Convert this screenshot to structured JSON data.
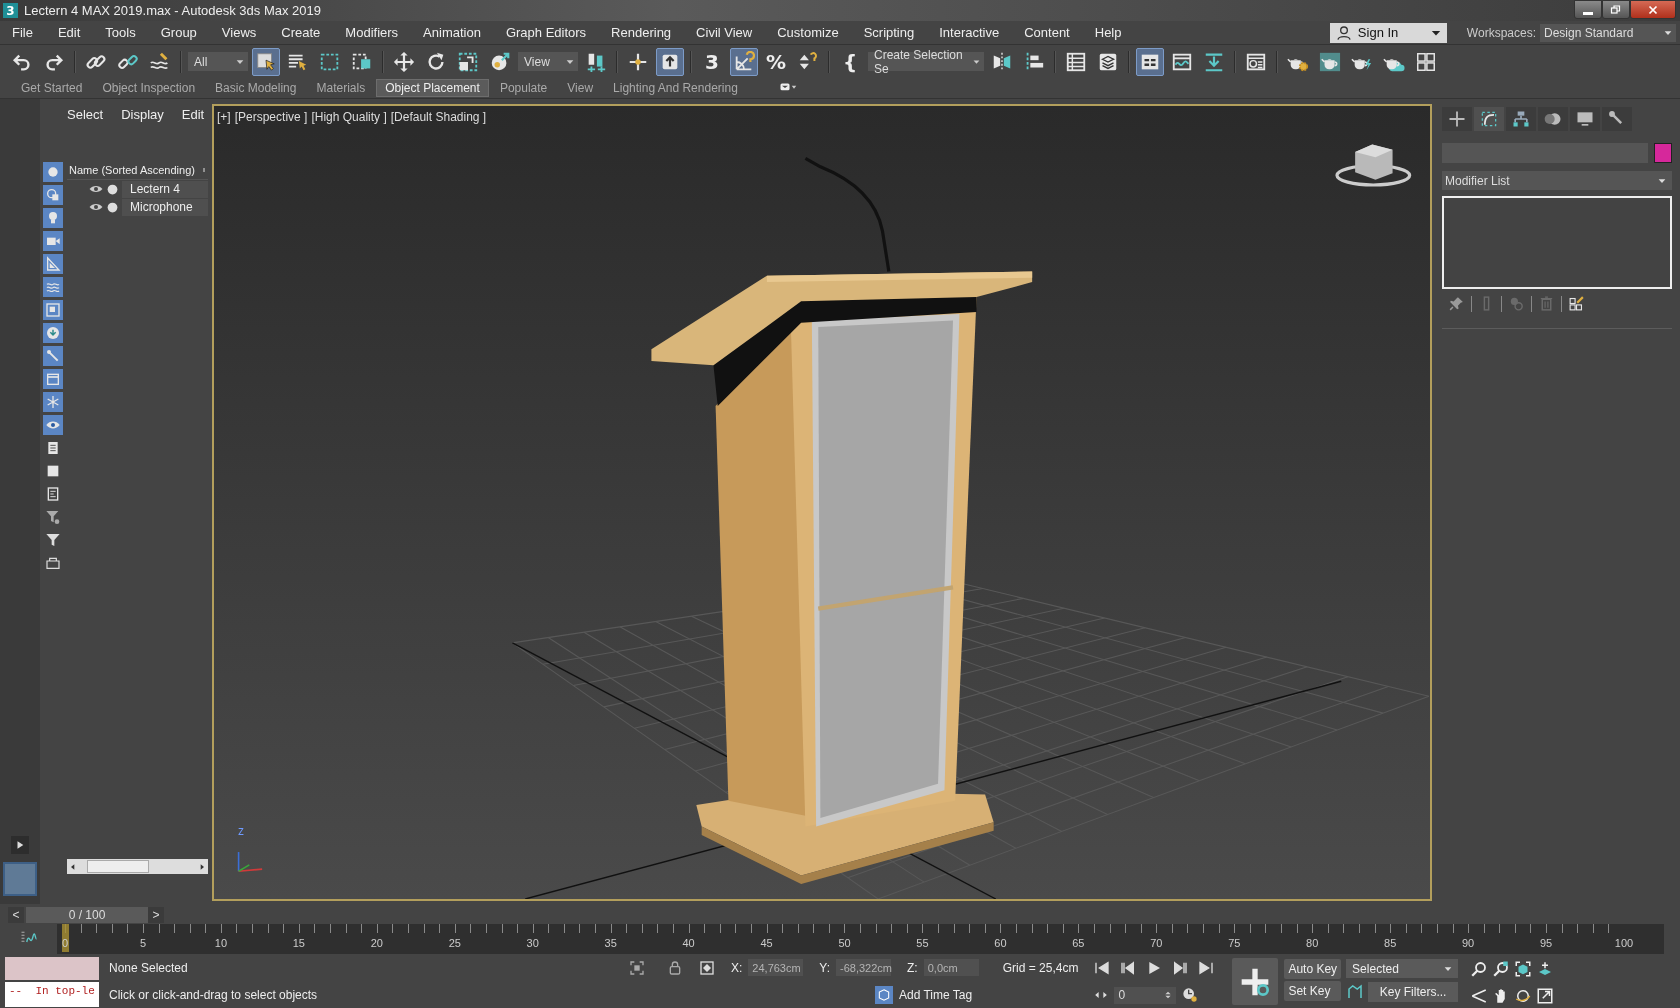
{
  "window": {
    "app_icon": "3",
    "title": "Lectern 4 MAX 2019.max - Autodesk 3ds Max 2019"
  },
  "menu": [
    "File",
    "Edit",
    "Tools",
    "Group",
    "Views",
    "Create",
    "Modifiers",
    "Animation",
    "Graph Editors",
    "Rendering",
    "Civil View",
    "Customize",
    "Scripting",
    "Interactive",
    "Content",
    "Help"
  ],
  "account": {
    "label": "Sign In"
  },
  "workspaces": {
    "label": "Workspaces:",
    "value": "Design Standard"
  },
  "toolbar": [
    {
      "kind": "undo",
      "on": false
    },
    {
      "kind": "redo",
      "on": false
    },
    {
      "kind": "sep"
    },
    {
      "kind": "link",
      "on": false
    },
    {
      "kind": "unlink",
      "on": false
    },
    {
      "kind": "bind",
      "on": false
    },
    {
      "kind": "sep"
    },
    {
      "kind": "dropdown",
      "value": "All"
    },
    {
      "kind": "select",
      "on": true
    },
    {
      "kind": "select_by_name",
      "on": false
    },
    {
      "kind": "rect_region",
      "on": false
    },
    {
      "kind": "window_crossing",
      "on": false
    },
    {
      "kind": "sep"
    },
    {
      "kind": "move",
      "on": false
    },
    {
      "kind": "rotate",
      "on": false
    },
    {
      "kind": "scale",
      "on": false
    },
    {
      "kind": "place",
      "on": false
    },
    {
      "kind": "dropdown",
      "value": "View"
    },
    {
      "kind": "pivot",
      "on": false
    },
    {
      "kind": "sep"
    },
    {
      "kind": "manipulate",
      "on": false
    },
    {
      "kind": "shortcut",
      "on": true
    },
    {
      "kind": "sep"
    },
    {
      "kind": "snap",
      "label": "3",
      "on": false
    },
    {
      "kind": "angle_snap",
      "on": true
    },
    {
      "kind": "percent_snap",
      "label": "%",
      "on": false
    },
    {
      "kind": "spinner_snap",
      "on": false
    },
    {
      "kind": "sep"
    },
    {
      "kind": "named_sel",
      "label": "{",
      "on": false
    },
    {
      "kind": "dropdown",
      "value": "Create Selection Se"
    },
    {
      "kind": "mirror",
      "on": false
    },
    {
      "kind": "align",
      "on": false
    },
    {
      "kind": "sep"
    },
    {
      "kind": "scene_explorer",
      "on": false
    },
    {
      "kind": "layer",
      "on": false
    },
    {
      "kind": "sep"
    },
    {
      "kind": "ribbon",
      "on": true
    },
    {
      "kind": "curve",
      "on": false
    },
    {
      "kind": "schematic",
      "on": false
    },
    {
      "kind": "sep"
    },
    {
      "kind": "frame_window",
      "on": false
    },
    {
      "kind": "sep"
    },
    {
      "kind": "render_setup",
      "on": false
    },
    {
      "kind": "rendered_frame",
      "on": false
    },
    {
      "kind": "render",
      "on": false
    },
    {
      "kind": "render_cloud",
      "on": false
    },
    {
      "kind": "gallery",
      "on": false
    }
  ],
  "ribbon_tabs": [
    {
      "label": "Get Started",
      "selected": false
    },
    {
      "label": "Object Inspection",
      "selected": false
    },
    {
      "label": "Basic Modeling",
      "selected": false
    },
    {
      "label": "Materials",
      "selected": false
    },
    {
      "label": "Object Placement",
      "selected": true
    },
    {
      "label": "Populate",
      "selected": false
    },
    {
      "label": "View",
      "selected": false
    },
    {
      "label": "Lighting And Rendering",
      "selected": false
    }
  ],
  "scene_explorer": {
    "menu": [
      "Select",
      "Display",
      "Edit"
    ],
    "filters": [
      {
        "kind": "geometry",
        "on": true
      },
      {
        "kind": "shape",
        "on": true
      },
      {
        "kind": "light",
        "on": true
      },
      {
        "kind": "camera",
        "on": true
      },
      {
        "kind": "helper",
        "on": true
      },
      {
        "kind": "spacewarp",
        "on": true
      },
      {
        "kind": "group",
        "on": true
      },
      {
        "kind": "xref",
        "on": true
      },
      {
        "kind": "bone",
        "on": true
      },
      {
        "kind": "container",
        "on": true
      },
      {
        "kind": "frozen",
        "on": true
      },
      {
        "kind": "hidden",
        "on": true
      },
      {
        "kind": "children",
        "on": false
      },
      {
        "kind": "influences",
        "on": false
      },
      {
        "kind": "dependents",
        "on": false
      }
    ],
    "column": "Name (Sorted Ascending)",
    "rows": [
      {
        "name": "Lectern 4"
      },
      {
        "name": "Microphone"
      }
    ]
  },
  "viewport": {
    "labels": [
      "[+]",
      "[Perspective ]",
      "[High Quality ]",
      "[Default Shading ]"
    ],
    "active": true,
    "axis_label": "z"
  },
  "command_panel": {
    "tabs": [
      {
        "kind": "create",
        "selected": false
      },
      {
        "kind": "modify",
        "selected": true
      },
      {
        "kind": "hierarchy",
        "selected": false
      },
      {
        "kind": "motion",
        "selected": false
      },
      {
        "kind": "display",
        "selected": false
      },
      {
        "kind": "utilities",
        "selected": false
      }
    ],
    "modifier_list": "Modifier List",
    "stack_tools": [
      {
        "kind": "pin",
        "disabled": false
      },
      {
        "kind": "end_result",
        "disabled": true
      },
      {
        "kind": "make_unique",
        "disabled": true
      },
      {
        "kind": "remove",
        "disabled": true
      },
      {
        "kind": "configure",
        "disabled": false
      }
    ]
  },
  "time_slider": {
    "prev": "<",
    "label": "0 / 100",
    "next": ">",
    "level": 0
  },
  "track_bar": {
    "ticks": [
      "0",
      "5",
      "10",
      "15",
      "20",
      "25",
      "30",
      "35",
      "40",
      "45",
      "50",
      "55",
      "60",
      "65",
      "70",
      "75",
      "80",
      "85",
      "90",
      "95",
      "100"
    ]
  },
  "listener": {
    "output": "--  In top-le"
  },
  "status": {
    "selection": "None Selected",
    "prompt": "Click or click-and-drag to select objects"
  },
  "coordinates": [
    {
      "axis": "X:",
      "value": "24,763cm"
    },
    {
      "axis": "Y:",
      "value": "-68,322cm"
    },
    {
      "axis": "Z:",
      "value": "0,0cm"
    }
  ],
  "grid": "Grid = 25,4cm",
  "time_tag": "Add Time Tag",
  "frame": "0",
  "key_buttons": [
    "Auto Key",
    "Set Key"
  ],
  "key_mode": "Selected",
  "key_filters": "Key Filters..."
}
